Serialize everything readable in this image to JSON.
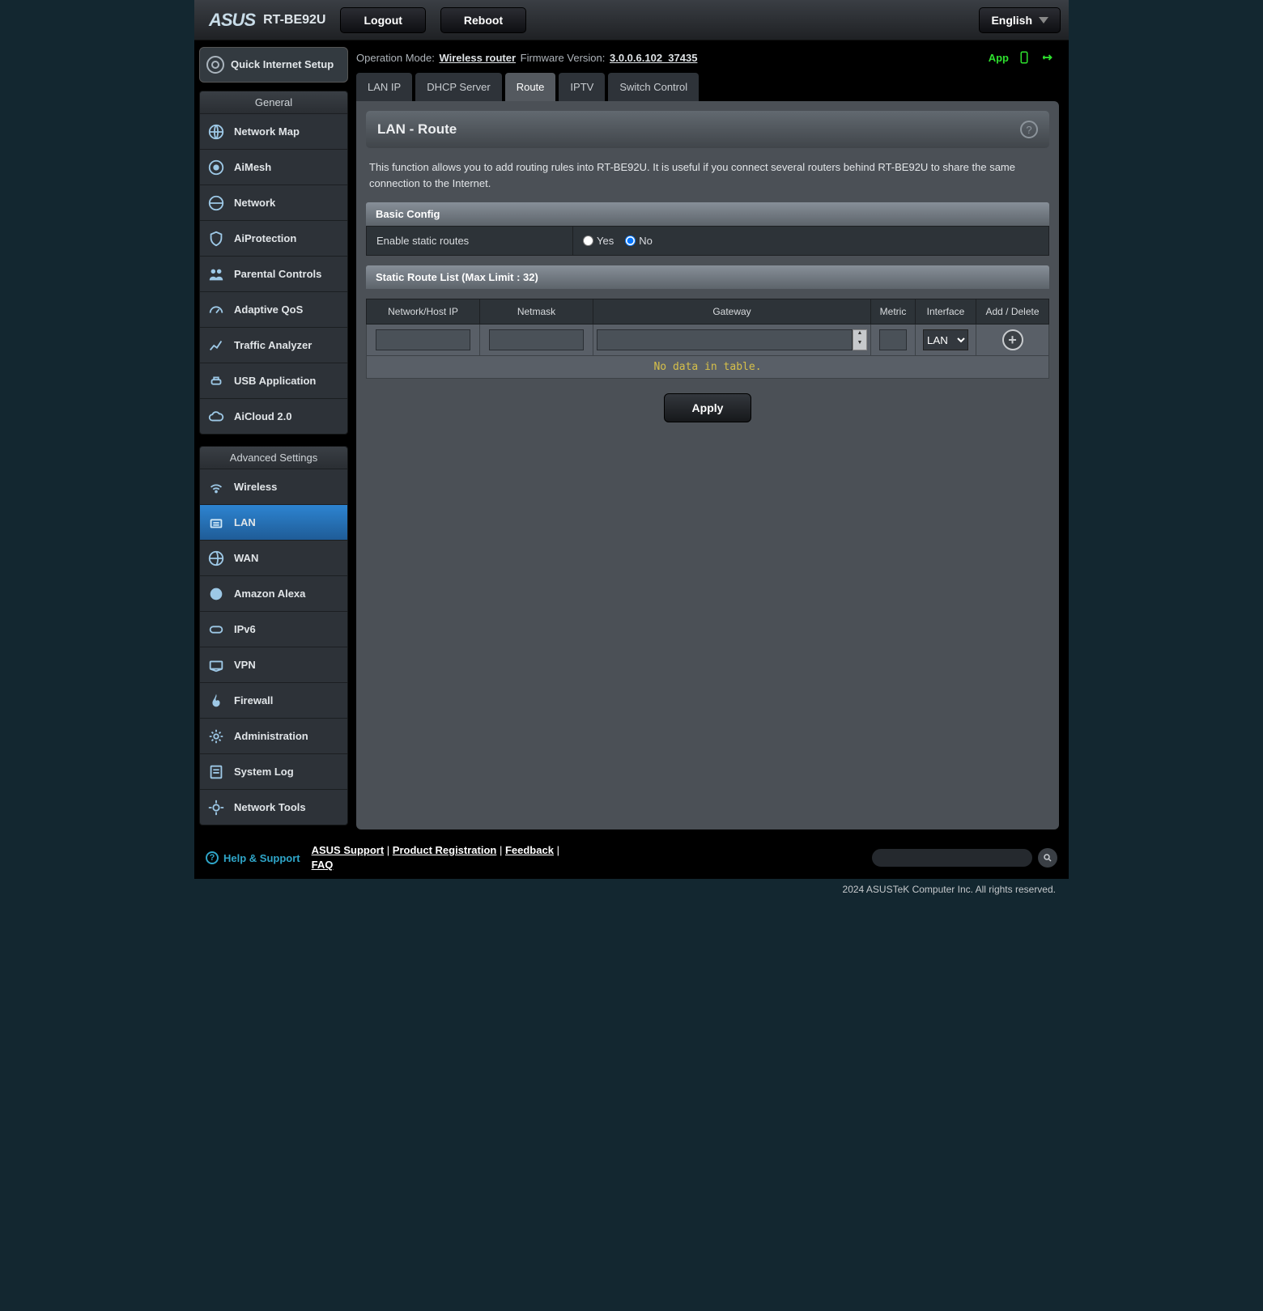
{
  "header": {
    "brand": "ASUS",
    "model": "RT-BE92U",
    "logout": "Logout",
    "reboot": "Reboot",
    "language": "English"
  },
  "status": {
    "op_mode_label": "Operation Mode:",
    "op_mode_value": "Wireless router",
    "fw_label": "Firmware Version:",
    "fw_value": "3.0.0.6.102_37435",
    "app_label": "App"
  },
  "qis": {
    "label": "Quick Internet Setup"
  },
  "general": {
    "header": "General",
    "items": [
      {
        "label": "Network Map"
      },
      {
        "label": "AiMesh"
      },
      {
        "label": "Network"
      },
      {
        "label": "AiProtection"
      },
      {
        "label": "Parental Controls"
      },
      {
        "label": "Adaptive QoS"
      },
      {
        "label": "Traffic Analyzer"
      },
      {
        "label": "USB Application"
      },
      {
        "label": "AiCloud 2.0"
      }
    ]
  },
  "advanced": {
    "header": "Advanced Settings",
    "items": [
      {
        "label": "Wireless"
      },
      {
        "label": "LAN"
      },
      {
        "label": "WAN"
      },
      {
        "label": "Amazon Alexa"
      },
      {
        "label": "IPv6"
      },
      {
        "label": "VPN"
      },
      {
        "label": "Firewall"
      },
      {
        "label": "Administration"
      },
      {
        "label": "System Log"
      },
      {
        "label": "Network Tools"
      }
    ],
    "active_index": 1
  },
  "tabs": {
    "items": [
      "LAN IP",
      "DHCP Server",
      "Route",
      "IPTV",
      "Switch Control"
    ],
    "active_index": 2
  },
  "page": {
    "title": "LAN - Route",
    "description": "This function allows you to add routing rules into RT-BE92U. It is useful if you connect several routers behind RT-BE92U to share the same connection to the Internet."
  },
  "basic": {
    "header": "Basic Config",
    "enable_label": "Enable static routes",
    "yes": "Yes",
    "no": "No",
    "selected": "no"
  },
  "routes": {
    "header": "Static Route List (Max Limit : 32)",
    "cols": {
      "host": "Network/Host IP",
      "netmask": "Netmask",
      "gateway": "Gateway",
      "metric": "Metric",
      "iface": "Interface",
      "action": "Add / Delete"
    },
    "iface_options": [
      "LAN"
    ],
    "iface_selected": "LAN",
    "empty": "No data in table."
  },
  "apply": "Apply",
  "footer": {
    "help": "Help & Support",
    "links": {
      "support": "ASUS Support",
      "reg": "Product Registration",
      "feedback": "Feedback",
      "faq": "FAQ",
      "sep": " | "
    },
    "copyright": "2024 ASUSTeK Computer Inc. All rights reserved."
  }
}
